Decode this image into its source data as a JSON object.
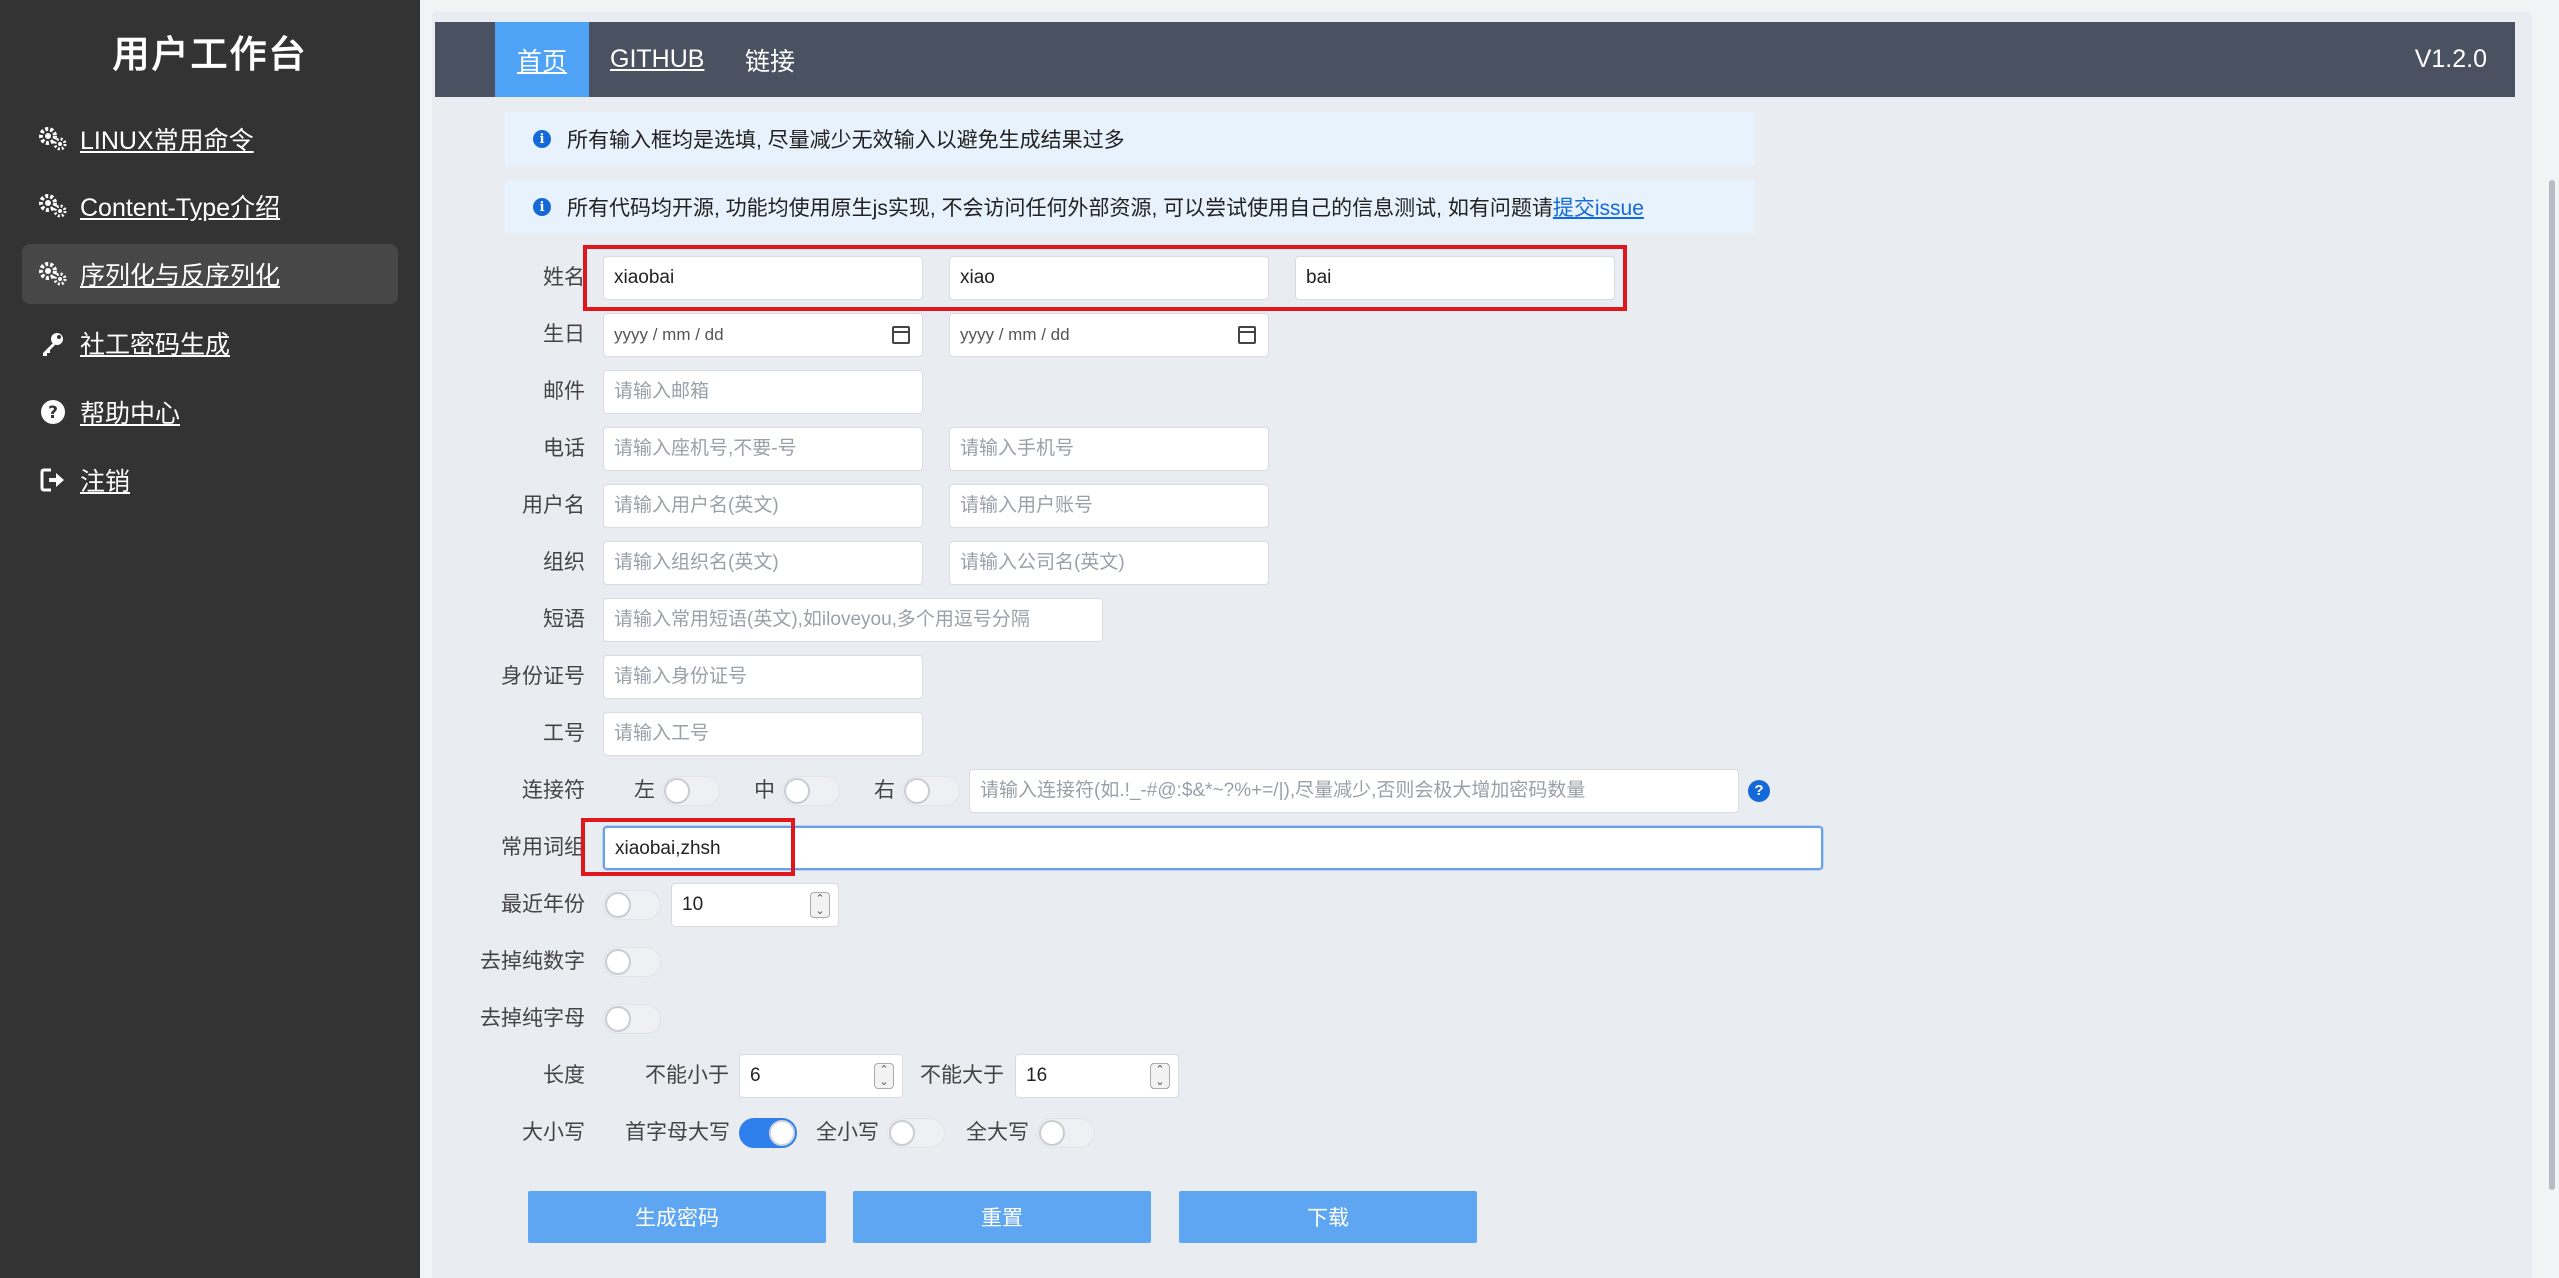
{
  "sidebar": {
    "title": "用户工作台",
    "items": [
      {
        "label": "LINUX常用命令",
        "icon": "gears-icon"
      },
      {
        "label": "Content-Type介绍",
        "icon": "gears-icon"
      },
      {
        "label": "序列化与反序列化",
        "icon": "gears-icon"
      },
      {
        "label": "社工密码生成",
        "icon": "key-icon"
      },
      {
        "label": "帮助中心",
        "icon": "question-circle-icon"
      },
      {
        "label": "注销",
        "icon": "sign-out-icon"
      }
    ],
    "active_index": 2
  },
  "header": {
    "tabs": [
      {
        "label": "首页"
      },
      {
        "label": "GITHUB"
      },
      {
        "label": "链接"
      }
    ],
    "version": "V1.2.0"
  },
  "notices": [
    {
      "text": "所有输入框均是选填, 尽量减少无效输入以避免生成结果过多"
    },
    {
      "text": "所有代码均开源, 功能均使用原生js实现, 不会访问任何外部资源, 可以尝试使用自己的信息测试, 如有问题请",
      "link": "提交issue"
    }
  ],
  "form": {
    "name": {
      "label": "姓名",
      "values": [
        "xiaobai",
        "xiao",
        "bai"
      ]
    },
    "birthday": {
      "label": "生日",
      "placeholders": [
        "yyyy / mm / dd",
        "yyyy / mm / dd"
      ]
    },
    "email": {
      "label": "邮件",
      "placeholder": "请输入邮箱"
    },
    "phone": {
      "label": "电话",
      "placeholders": [
        "请输入座机号,不要-号",
        "请输入手机号"
      ]
    },
    "username": {
      "label": "用户名",
      "placeholders": [
        "请输入用户名(英文)",
        "请输入用户账号"
      ]
    },
    "org": {
      "label": "组织",
      "placeholders": [
        "请输入组织名(英文)",
        "请输入公司名(英文)"
      ]
    },
    "phrase": {
      "label": "短语",
      "placeholder": "请输入常用短语(英文),如iloveyou,多个用逗号分隔"
    },
    "idcard": {
      "label": "身份证号",
      "placeholder": "请输入身份证号"
    },
    "jobno": {
      "label": "工号",
      "placeholder": "请输入工号"
    },
    "connector": {
      "label": "连接符",
      "left": "左",
      "mid": "中",
      "right": "右",
      "left_on": false,
      "mid_on": false,
      "right_on": false,
      "placeholder": "请输入连接符(如.!_-#@:$&*~?%+=/|),尽量减少,否则会极大增加密码数量",
      "help": "?"
    },
    "words": {
      "label": "常用词组",
      "value": "xiaobai,zhsh"
    },
    "recent_years": {
      "label": "最近年份",
      "enabled": false,
      "value": "10"
    },
    "remove_digits": {
      "label": "去掉纯数字",
      "enabled": false
    },
    "remove_letters": {
      "label": "去掉纯字母",
      "enabled": false
    },
    "length": {
      "label": "长度",
      "min_label": "不能小于",
      "min": "6",
      "max_label": "不能大于",
      "max": "16"
    },
    "case": {
      "label": "大小写",
      "options": [
        {
          "label": "首字母大写",
          "on": true
        },
        {
          "label": "全小写",
          "on": false
        },
        {
          "label": "全大写",
          "on": false
        }
      ]
    }
  },
  "buttons": {
    "generate": "生成密码",
    "reset": "重置",
    "download": "下载"
  },
  "colors": {
    "sidebar": "#333333",
    "topbar": "#4a5261",
    "accent": "#4fa3f7",
    "button": "#5ea6f2",
    "highlight": "#e0181e"
  }
}
